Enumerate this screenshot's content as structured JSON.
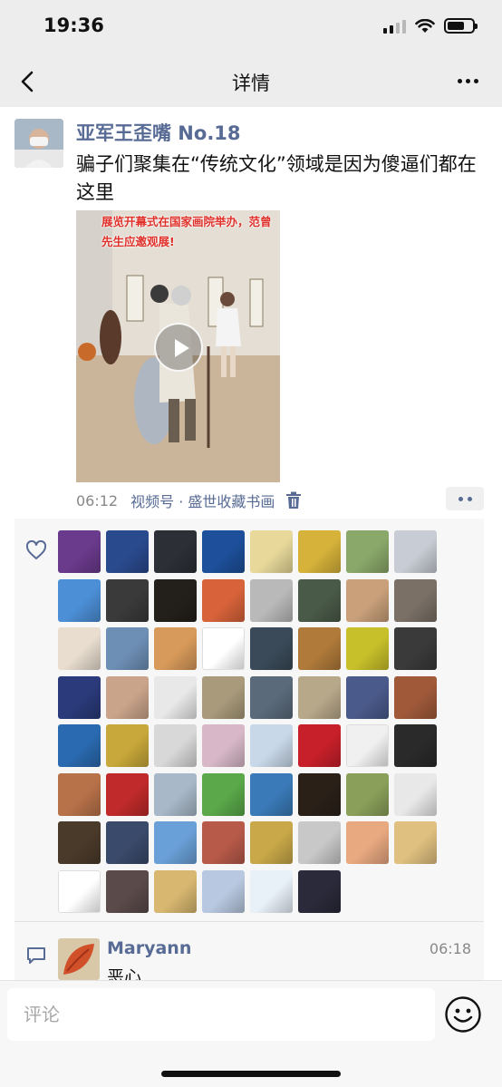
{
  "status_bar": {
    "time": "19:36",
    "battery_level": 0.7
  },
  "nav": {
    "title": "详情"
  },
  "post": {
    "author": "亚军王歪嘴 No.18",
    "text": "骗子们聚集在“传统文化”领域是因为傻逼们都在这里",
    "video_caption": "展览开幕式在国家画院举办，范曾先生应邀观展!",
    "time": "06:12",
    "channel": "视频号 · 盛世收藏书画"
  },
  "likes": {
    "count": 62,
    "avatar_colors": [
      "#6a3a8c",
      "#2a4a8e",
      "#2c2f36",
      "#1d4f9a",
      "#e8d99a",
      "#d6b23a",
      "#8aa86a",
      "#c8ccd4",
      "#4c8fd6",
      "#3a3a3a",
      "#231f1a",
      "#d8633a",
      "#b9b9b9",
      "#4a5a48",
      "#c9a07a",
      "#7a7066",
      "#e8ddcf",
      "#6d8fb5",
      "#d89a5a",
      "#ffffff",
      "#3a4a58",
      "#b07a3a",
      "#c8c02a",
      "#3a3a3a",
      "#2a3a7a",
      "#caa48a",
      "#e8e8e8",
      "#a89a7a",
      "#5a6a7a",
      "#b8a88a",
      "#4a5a8a",
      "#a05a3a",
      "#2a6ab0",
      "#c8a83a",
      "#d8d8d8",
      "#d8b8c8",
      "#c8d8e8",
      "#c8202a",
      "#f0f0f0",
      "#2a2a2a",
      "#b8724a",
      "#c02a2a",
      "#a8b8c8",
      "#5aa84a",
      "#3a7ab8",
      "#2a2018",
      "#8aa05a",
      "#e8e8e8",
      "#4a3a2a",
      "#3a4a6a",
      "#6aa0d8",
      "#b85a4a",
      "#c8a848",
      "#c8c8c8",
      "#e8a880",
      "#e0c080",
      "#ffffff",
      "#5a4a4a",
      "#d8b870",
      "#b8c8e0",
      "#e8f0f8",
      "#2a2a3a"
    ]
  },
  "comments": [
    {
      "author": "Maryann",
      "time": "06:18",
      "text": "恶心"
    }
  ],
  "input": {
    "placeholder": "评论"
  }
}
